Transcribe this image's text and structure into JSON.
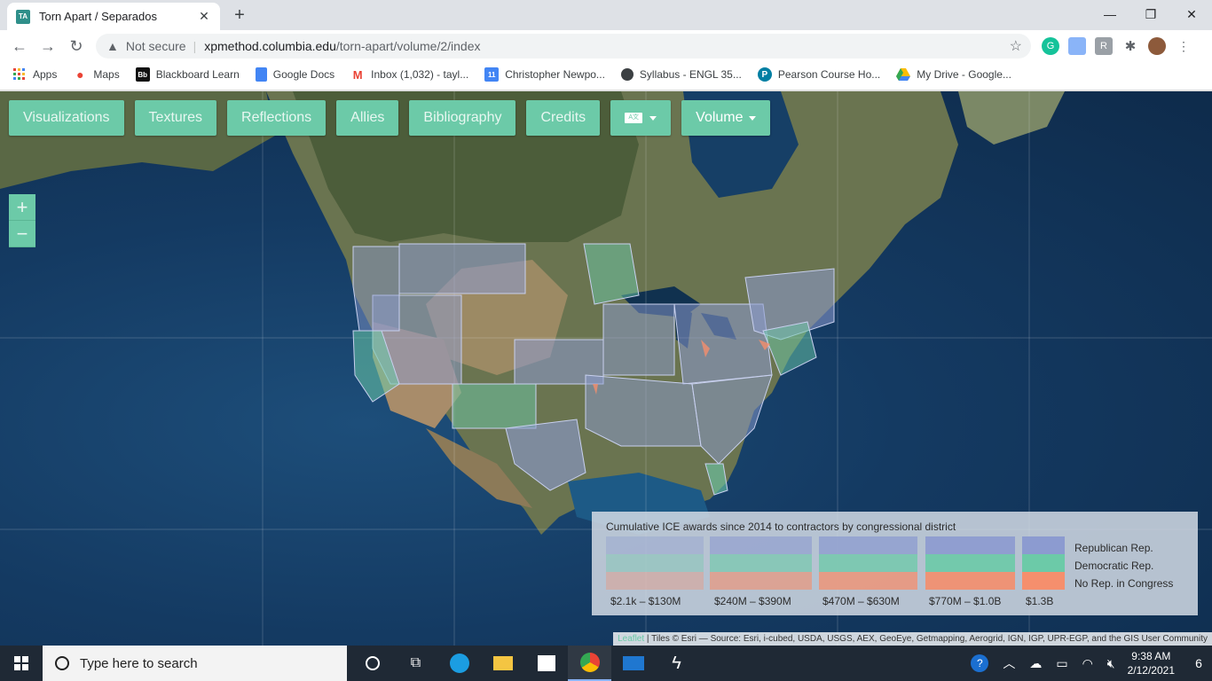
{
  "browser": {
    "tab_title": "Torn Apart / Separados",
    "tab_favicon_text": "TA",
    "security_label": "Not secure",
    "url_host": "xpmethod.columbia.edu",
    "url_path": "/torn-apart/volume/2/index",
    "bookmarks": [
      {
        "label": "Apps",
        "icon": "apps-grid-icon"
      },
      {
        "label": "Maps",
        "icon": "maps-pin-icon"
      },
      {
        "label": "Blackboard Learn",
        "icon": "blackboard-icon"
      },
      {
        "label": "Google Docs",
        "icon": "google-docs-icon"
      },
      {
        "label": "Inbox (1,032) - tayl...",
        "icon": "gmail-icon"
      },
      {
        "label": "Christopher Newpo...",
        "icon": "calendar-icon"
      },
      {
        "label": "Syllabus - ENGL 35...",
        "icon": "globe-icon"
      },
      {
        "label": "Pearson Course Ho...",
        "icon": "pearson-icon"
      },
      {
        "label": "My Drive - Google...",
        "icon": "google-drive-icon"
      }
    ]
  },
  "site_nav": {
    "items": [
      "Visualizations",
      "Textures",
      "Reflections",
      "Allies",
      "Bibliography",
      "Credits"
    ],
    "language_icon": "translate-icon",
    "volume_label": "Volume"
  },
  "zoom": {
    "in": "+",
    "out": "−"
  },
  "legend": {
    "title": "Cumulative ICE awards since 2014 to contractors by congressional district",
    "ranges": [
      "$2.1k – $130M",
      "$240M – $390M",
      "$470M – $630M",
      "$770M – $1.0B",
      "$1.3B"
    ],
    "keys": [
      "Republican Rep.",
      "Democratic Rep.",
      "No Rep. in Congress"
    ],
    "colors": {
      "republican": "#8c9bd0",
      "democratic": "#6ccaa8",
      "none": "#f58f6d"
    }
  },
  "attribution": {
    "leaflet": "Leaflet",
    "text": " | Tiles © Esri — Source: Esri, i-cubed, USDA, USGS, AEX, GeoEye, Getmapping, Aerogrid, IGN, IGP, UPR-EGP, and the GIS User Community"
  },
  "taskbar": {
    "search_placeholder": "Type here to search",
    "time": "9:38 AM",
    "date": "2/12/2021",
    "notification_count": "6"
  }
}
